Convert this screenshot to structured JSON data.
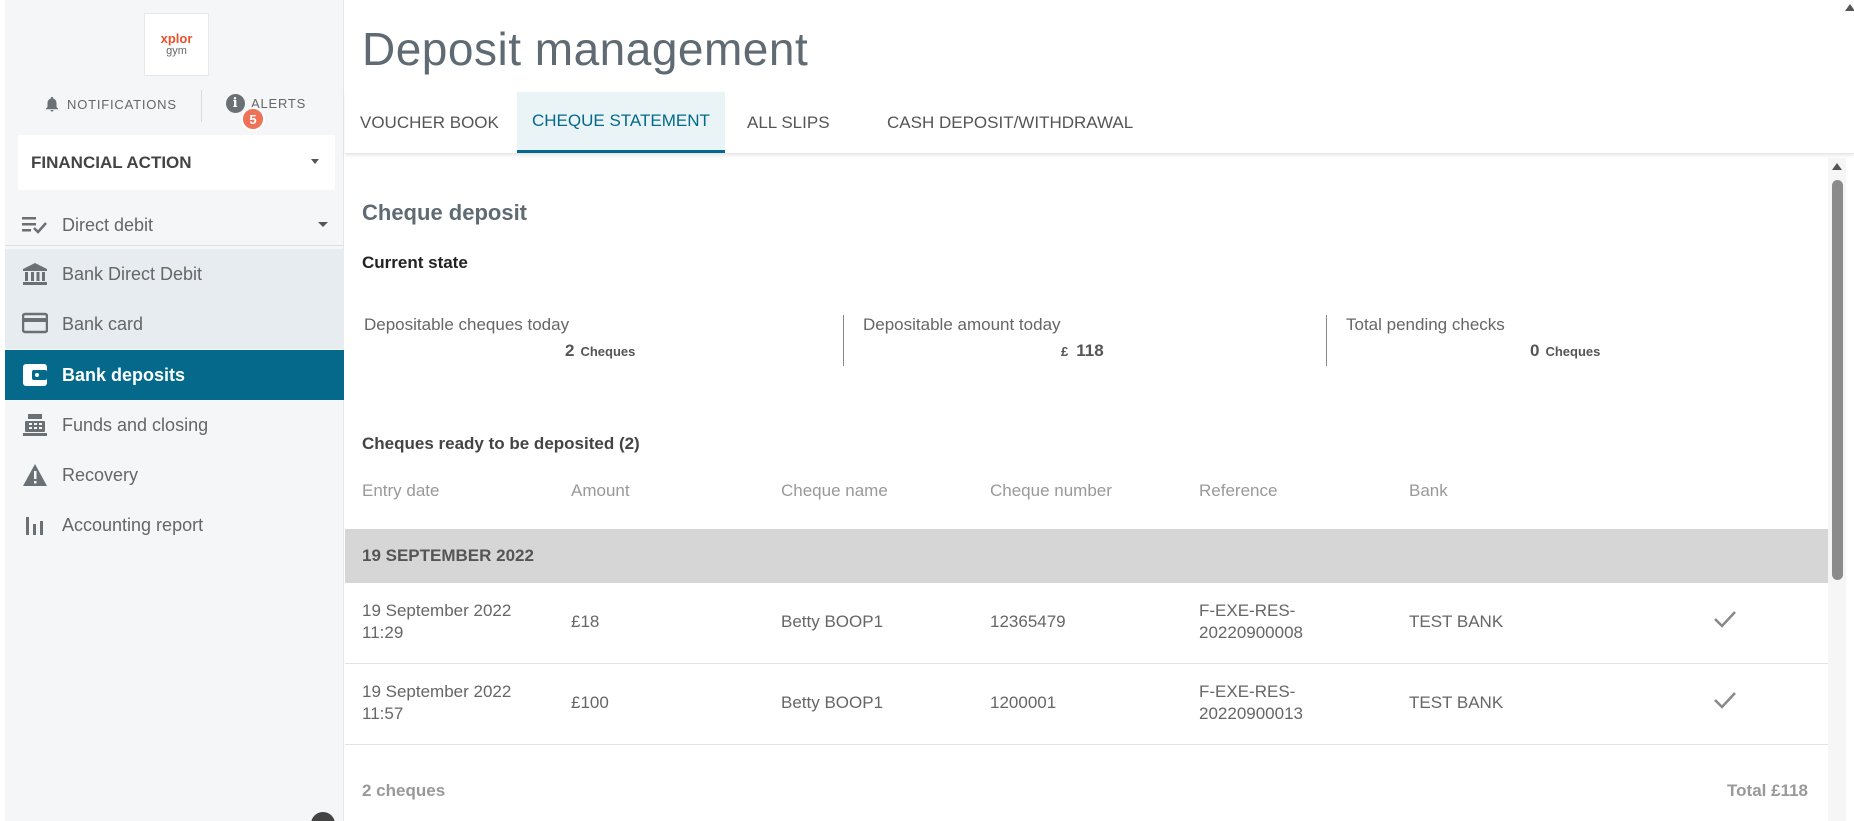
{
  "sidebar": {
    "logo": {
      "top": "xplor",
      "bottom": "gym"
    },
    "notifications_label": "NOTIFICATIONS",
    "alerts_label": "ALERTS",
    "alerts_count": "5",
    "financial_select": "FINANCIAL ACTION",
    "section": {
      "label": "Direct debit",
      "icon": "checklist-icon"
    },
    "items": [
      {
        "label": "Bank Direct Debit",
        "icon": "bank-icon",
        "state": "sub"
      },
      {
        "label": "Bank card",
        "icon": "credit-card-icon",
        "state": "sub"
      },
      {
        "label": "Bank deposits",
        "icon": "wallet-icon",
        "state": "active"
      },
      {
        "label": "Funds and closing",
        "icon": "cash-register-icon",
        "state": "normal"
      },
      {
        "label": "Recovery",
        "icon": "warning-icon",
        "state": "normal"
      },
      {
        "label": "Accounting report",
        "icon": "bar-chart-icon",
        "state": "normal"
      }
    ]
  },
  "header": {
    "title": "Deposit management"
  },
  "tabs": [
    {
      "label": "VOUCHER BOOK",
      "active": false
    },
    {
      "label": "CHEQUE STATEMENT",
      "active": true
    },
    {
      "label": "ALL SLIPS",
      "active": false
    },
    {
      "label": "CASH DEPOSIT/WITHDRAWAL",
      "active": false
    }
  ],
  "content": {
    "title": "Cheque deposit",
    "current_state_label": "Current state",
    "stats": [
      {
        "label": "Depositable cheques today",
        "value": "2",
        "unit": "Cheques"
      },
      {
        "label": "Depositable amount today",
        "currency": "£",
        "value": "118"
      },
      {
        "label": "Total pending checks",
        "value": "0",
        "unit": "Cheques"
      }
    ],
    "ready_label": "Cheques ready to be deposited (2)",
    "columns": [
      "Entry date",
      "Amount",
      "Cheque name",
      "Cheque number",
      "Reference",
      "Bank"
    ],
    "group": "19 SEPTEMBER 2022",
    "rows": [
      {
        "date": "19 September 2022",
        "time": "11:29",
        "amount": "£18",
        "name": "Betty BOOP1",
        "number": "12365479",
        "ref1": "F-EXE-RES-",
        "ref2": "20220900008",
        "bank": "TEST BANK"
      },
      {
        "date": "19 September 2022",
        "time": "11:57",
        "amount": "£100",
        "name": "Betty BOOP1",
        "number": "1200001",
        "ref1": "F-EXE-RES-",
        "ref2": "20220900013",
        "bank": "TEST BANK"
      }
    ],
    "footer": {
      "count": "2 cheques",
      "total": "Total £118"
    }
  },
  "colors": {
    "accent": "#04698a",
    "badge": "#ef7158",
    "group_row": "#d6d6d6"
  }
}
